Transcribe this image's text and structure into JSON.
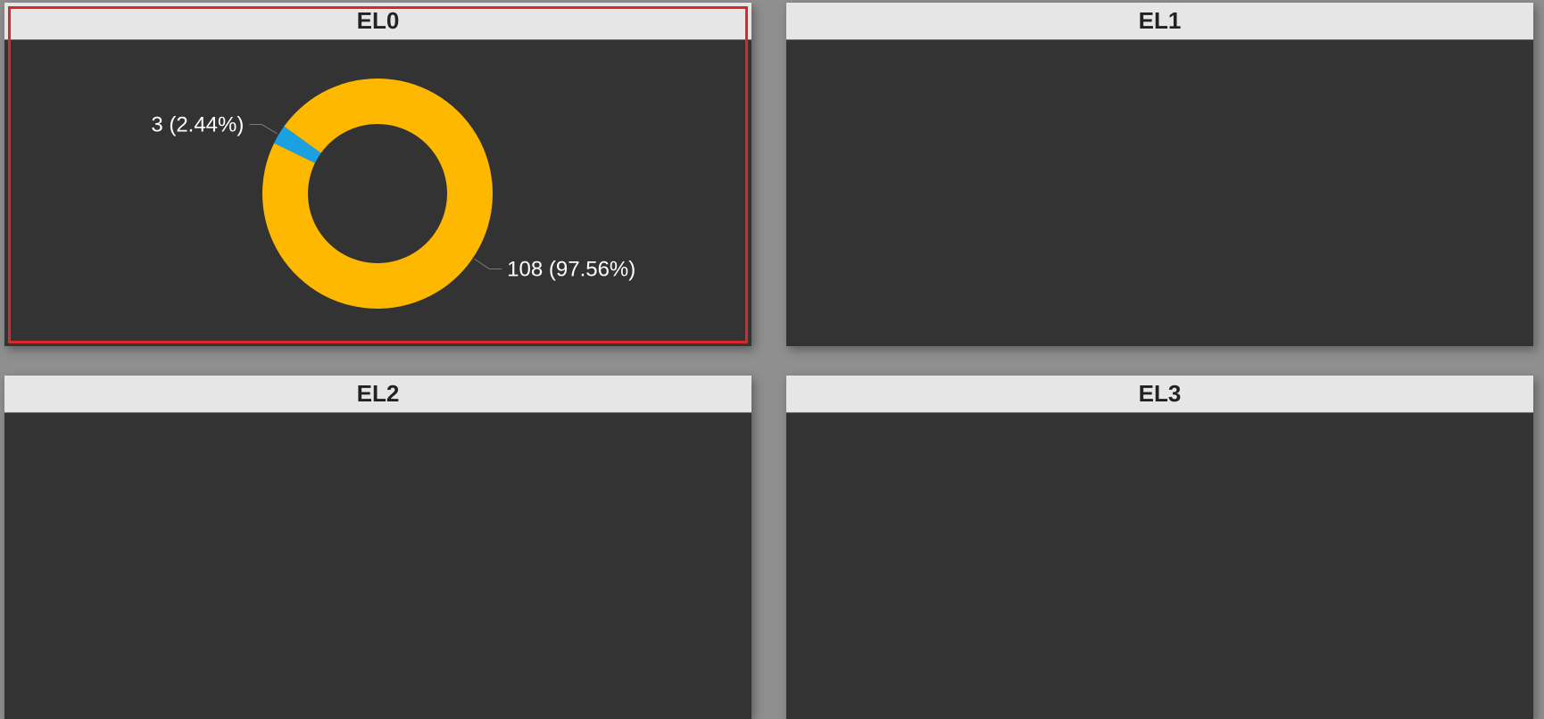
{
  "panels": [
    {
      "title": "EL0"
    },
    {
      "title": "EL1"
    },
    {
      "title": "EL2"
    },
    {
      "title": "EL3"
    }
  ],
  "colors": {
    "accent_selected": "#d62a2a",
    "slice_main": "#FFB800",
    "slice_minor": "#1BA1E2",
    "panel_bg": "#333333",
    "header_bg": "#e6e6e6"
  },
  "chart_data": {
    "type": "pie",
    "variant": "donut",
    "slices": [
      {
        "value": 3,
        "percent": 2.44,
        "label": "3 (2.44%)",
        "color": "#1BA1E2"
      },
      {
        "value": 108,
        "percent": 97.56,
        "label": "108 (97.56%)",
        "color": "#FFB800"
      }
    ],
    "title": "EL0"
  }
}
